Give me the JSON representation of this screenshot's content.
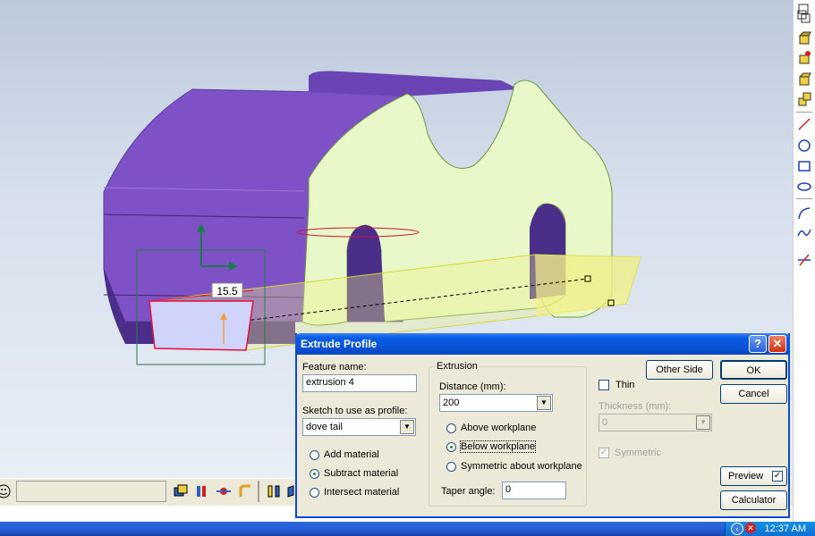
{
  "viewport": {
    "dimension_value": "15.5"
  },
  "colors": {
    "body_purple": "#7e52c6",
    "face_green": "#e8f8c8",
    "profile_fill": "#d0d4fb",
    "profile_edge": "#e01040",
    "preview_yellow": "#f2f08a"
  },
  "right_toolbar": {
    "icons": [
      "sketch-icon",
      "workplane-icon",
      "extrude-icon",
      "revolve-icon",
      "sweep-icon",
      "loft-icon",
      "line-icon",
      "circle-icon",
      "rectangle-icon",
      "ellipse-icon",
      "arc-icon",
      "spline-icon",
      "trim-icon"
    ]
  },
  "bottom_toolbar": {
    "icons": [
      "smiley-icon",
      "view-icon",
      "part-icon",
      "flow-icon",
      "pipe-icon",
      "bracket-icon",
      "align-icon"
    ]
  },
  "taskbar": {
    "clock": "12:37 AM"
  },
  "dialog": {
    "title": "Extrude Profile",
    "help_label": "?",
    "close_label": "✕",
    "feature_name_label": "Feature name:",
    "feature_name_value": "extrusion 4",
    "sketch_label": "Sketch to use as profile:",
    "sketch_value": "dove tail",
    "add_material": "Add material",
    "subtract_material": "Subtract material",
    "intersect_material": "Intersect material",
    "extrusion_group": "Extrusion",
    "distance_label": "Distance (mm):",
    "distance_value": "200",
    "above_workplane": "Above workplane",
    "below_workplane": "Below workplane",
    "symmetric_workplane": "Symmetric about workplane",
    "taper_label": "Taper angle:",
    "taper_value": "0",
    "other_side": "Other Side",
    "thin": "Thin",
    "thickness_label": "Thickness (mm):",
    "thickness_value": "0",
    "symmetric": "Symmetric",
    "ok": "OK",
    "cancel": "Cancel",
    "preview": "Preview",
    "calculator": "Calculator"
  }
}
